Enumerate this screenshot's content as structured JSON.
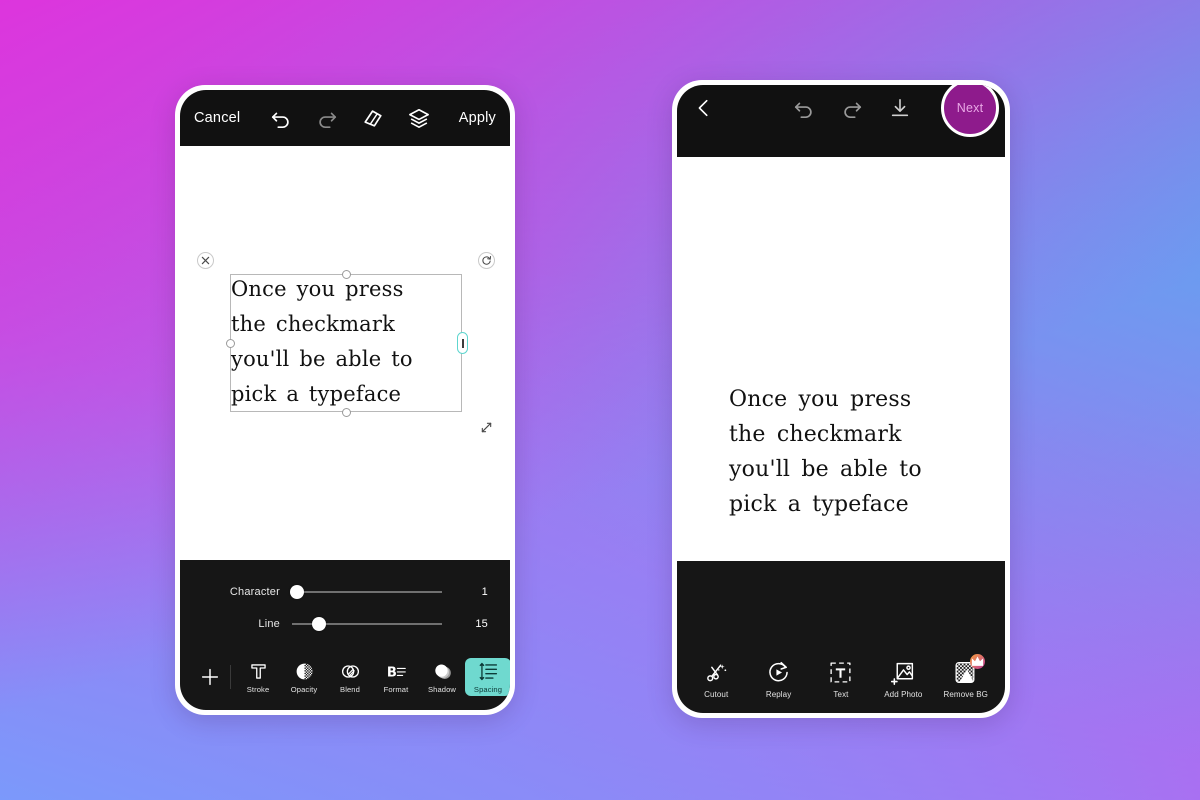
{
  "background": {
    "colors": [
      "#dd35dd",
      "#55aaf0",
      "#c854ec",
      "#7b99fb"
    ]
  },
  "left_phone": {
    "topbar": {
      "cancel_label": "Cancel",
      "apply_label": "Apply",
      "icons": [
        "undo-icon",
        "redo-icon",
        "eraser-icon",
        "layers-icon"
      ]
    },
    "text_object": {
      "content": "Once you press\nthe checkmark\nyou'll be able to\npick a typeface",
      "selection_handle_color": "#5fd6cf",
      "close_glyph": "×",
      "rotate_glyph": "↻",
      "resize_glyph": "⤡"
    },
    "sliders": [
      {
        "label": "Character",
        "value": "1",
        "percent": 3
      },
      {
        "label": "Line",
        "value": "15",
        "percent": 18
      }
    ],
    "dock": {
      "add_glyph": "+",
      "tools": [
        {
          "label": "Stroke",
          "icon": "stroke-t-icon",
          "active": false
        },
        {
          "label": "Opacity",
          "icon": "opacity-icon",
          "active": false
        },
        {
          "label": "Blend",
          "icon": "blend-icon",
          "active": false
        },
        {
          "label": "Format",
          "icon": "format-bold-icon",
          "active": false
        },
        {
          "label": "Shadow",
          "icon": "shadow-icon",
          "active": false
        },
        {
          "label": "Spacing",
          "icon": "spacing-icon",
          "active": true
        }
      ]
    }
  },
  "right_phone": {
    "topbar": {
      "next_label": "Next",
      "next_color": "#8e1b8c",
      "icons": [
        "back-chevron-icon",
        "undo-icon",
        "redo-icon",
        "download-icon"
      ]
    },
    "canvas_text": "Once you press\nthe checkmark\nyou'll be able to\npick a typeface",
    "dock": {
      "tools": [
        {
          "label": "Cutout",
          "icon": "cutout-scissors-icon",
          "badge": false
        },
        {
          "label": "Replay",
          "icon": "replay-icon",
          "badge": false
        },
        {
          "label": "Text",
          "icon": "text-box-icon",
          "badge": false
        },
        {
          "label": "Add Photo",
          "icon": "add-photo-icon",
          "badge": false
        },
        {
          "label": "Remove BG",
          "icon": "remove-bg-icon",
          "badge": true
        }
      ]
    }
  }
}
